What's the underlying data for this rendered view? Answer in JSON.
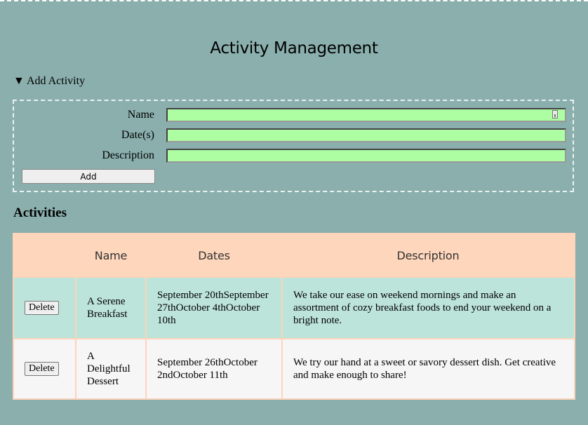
{
  "page": {
    "title": "Activity Management"
  },
  "add_form": {
    "summary": "▼ Add Activity",
    "name_label": "Name",
    "name_value": "",
    "dates_label": "Date(s)",
    "dates_value": "",
    "description_label": "Description",
    "description_value": "",
    "add_button_label": "Add"
  },
  "activities": {
    "heading": "Activities",
    "columns": [
      "",
      "Name",
      "Dates",
      "Description"
    ],
    "rows": [
      {
        "delete_label": "Delete",
        "name": "A Serene Breakfast",
        "dates": "September 20thSeptember 27thOctober 4thOctober 10th",
        "description": "We take our ease on weekend mornings and make an assortment of cozy breakfast foods to end your weekend on a bright note."
      },
      {
        "delete_label": "Delete",
        "name": "A Delightful Dessert",
        "dates": "September 26thOctober 2ndOctober 11th",
        "description": "We try our hand at a sweet or savory dessert dish. Get creative and make enough to share!"
      }
    ]
  },
  "colors": {
    "background": "#8aafad",
    "input_fill": "#adfea2",
    "table_header": "#fed6bc",
    "row_highlight": "#bde4da",
    "row_plain": "#f6f6f6"
  },
  "icons": {
    "autofill": "autofill-key-icon"
  }
}
